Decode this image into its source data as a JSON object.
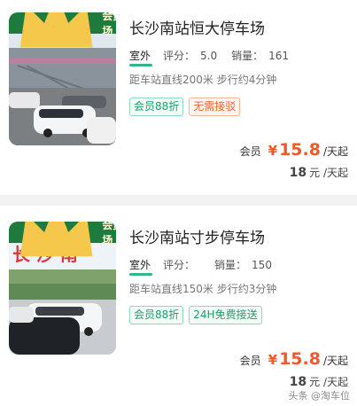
{
  "listings": [
    {
      "badge": "会员车场",
      "title": "长沙南站恒大停车场",
      "type": "室外",
      "rating_label": "评分：",
      "rating": "5.0",
      "sales_label": "销量：",
      "sales": "161",
      "distance": "距车站直线200米 步行约4分钟",
      "tags": [
        "会员88折",
        "无需接驳"
      ],
      "member_label": "会员",
      "currency": "¥",
      "member_price": "15.8",
      "price_unit": "/天起",
      "base_price": "18",
      "base_unit": "元 /天起"
    },
    {
      "badge": "会员车场",
      "title": "长沙南站寸步停车场",
      "type": "室外",
      "rating_label": "评分：",
      "rating": "",
      "sales_label": "销量：",
      "sales": "150",
      "distance": "距车站直线150米 步行约3分钟",
      "tags": [
        "会员88折",
        "24H免费接送"
      ],
      "member_label": "会员",
      "currency": "¥",
      "member_price": "15.8",
      "price_unit": "/天起",
      "base_price": "18",
      "base_unit": "元 /天起",
      "photo_sign": "长 沙 南"
    }
  ],
  "watermark": "头条 @淘车位",
  "colors": {
    "accent_green": "#1d9e6a",
    "price_orange": "#f05a28",
    "badge_green": "#1f7a3e"
  }
}
